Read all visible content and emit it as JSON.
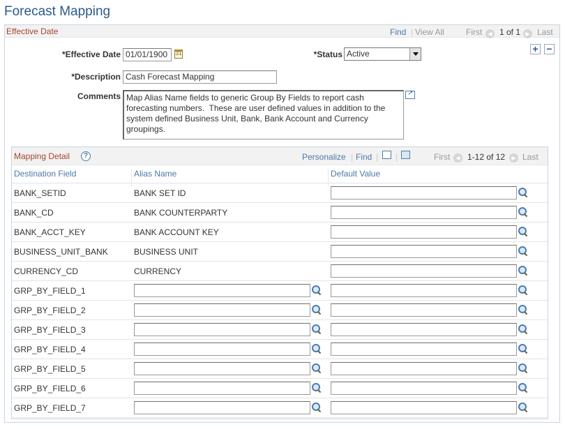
{
  "page_title": "Forecast Mapping",
  "effective_date_section": {
    "label": "Effective Date",
    "nav": {
      "find": "Find",
      "sep": "|",
      "view_all": "View All",
      "first": "First",
      "range": "1 of 1",
      "last": "Last"
    }
  },
  "form": {
    "effective_date_label": "*Effective Date",
    "effective_date_value": "01/01/1900",
    "status_label": "*Status",
    "status_value": "Active",
    "description_label": "*Description",
    "description_value": "Cash Forecast Mapping",
    "comments_label": "Comments",
    "comments_value": "Map Alias Name fields to generic Group By Fields to report cash\nforecasting numbers.  These are user defined values in addition to the\nsystem defined Business Unit, Bank, Bank Account and Currency\ngroupings.",
    "add_row": "+",
    "delete_row": "−",
    "calendar_glyph": "31"
  },
  "grid": {
    "title": "Mapping Detail",
    "help": "?",
    "nav": {
      "personalize": "Personalize",
      "sep": "|",
      "find": "Find",
      "first": "First",
      "range": "1-12 of 12",
      "last": "Last"
    },
    "columns": [
      "Destination Field",
      "Alias Name",
      "Default Value"
    ],
    "rows": [
      {
        "field": "BANK_SETID",
        "alias": "BANK SET ID"
      },
      {
        "field": "BANK_CD",
        "alias": "BANK COUNTERPARTY"
      },
      {
        "field": "BANK_ACCT_KEY",
        "alias": "BANK ACCOUNT KEY"
      },
      {
        "field": "BUSINESS_UNIT_BANK",
        "alias": "BUSINESS UNIT"
      },
      {
        "field": "CURRENCY_CD",
        "alias": "CURRENCY"
      },
      {
        "field": "GRP_BY_FIELD_1",
        "alias": ""
      },
      {
        "field": "GRP_BY_FIELD_2",
        "alias": ""
      },
      {
        "field": "GRP_BY_FIELD_3",
        "alias": ""
      },
      {
        "field": "GRP_BY_FIELD_4",
        "alias": ""
      },
      {
        "field": "GRP_BY_FIELD_5",
        "alias": ""
      },
      {
        "field": "GRP_BY_FIELD_6",
        "alias": ""
      },
      {
        "field": "GRP_BY_FIELD_7",
        "alias": ""
      }
    ],
    "alias_editable": [
      false,
      false,
      false,
      false,
      false,
      true,
      true,
      true,
      true,
      true,
      true,
      true
    ]
  },
  "icons": {
    "calendar": "calendar-icon",
    "lookup": "lookup-icon",
    "expand": "expand-text-icon",
    "help": "help-icon",
    "zoom": "view-zoom-icon",
    "download": "download-grid-icon"
  },
  "colors": {
    "title": "#2c5a8c",
    "section_label": "#a5462d",
    "link": "#4b79a8"
  }
}
